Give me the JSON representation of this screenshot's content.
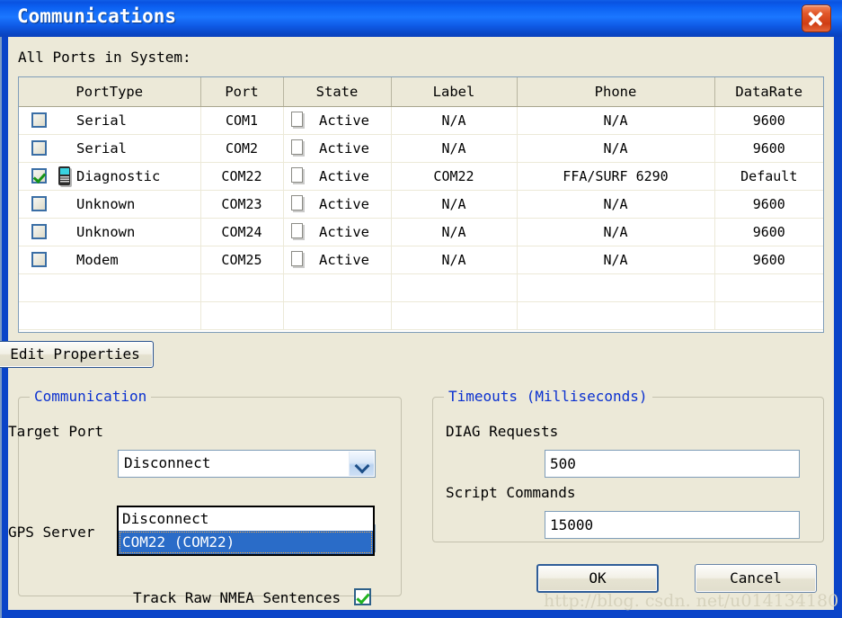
{
  "window": {
    "title": "Communications",
    "close_icon": "close-icon",
    "accent_titlebar": "#1b77ff",
    "frame_color": "#0a44c8",
    "face_color": "#ece9d8"
  },
  "ports_section": {
    "heading": "All Ports in System:",
    "columns": [
      "PortType",
      "Port",
      "State",
      "Label",
      "Phone",
      "DataRate"
    ],
    "rows": [
      {
        "checked": false,
        "has_device_icon": false,
        "port_type": "Serial",
        "port": "COM1",
        "state": "Active",
        "label": "N/A",
        "phone": "N/A",
        "data_rate": "9600"
      },
      {
        "checked": false,
        "has_device_icon": false,
        "port_type": "Serial",
        "port": "COM2",
        "state": "Active",
        "label": "N/A",
        "phone": "N/A",
        "data_rate": "9600"
      },
      {
        "checked": true,
        "has_device_icon": true,
        "port_type": "Diagnostic",
        "port": "COM22",
        "state": "Active",
        "label": "COM22",
        "phone": "FFA/SURF 6290",
        "data_rate": "Default"
      },
      {
        "checked": false,
        "has_device_icon": false,
        "port_type": "Unknown",
        "port": "COM23",
        "state": "Active",
        "label": "N/A",
        "phone": "N/A",
        "data_rate": "9600"
      },
      {
        "checked": false,
        "has_device_icon": false,
        "port_type": "Unknown",
        "port": "COM24",
        "state": "Active",
        "label": "N/A",
        "phone": "N/A",
        "data_rate": "9600"
      },
      {
        "checked": false,
        "has_device_icon": false,
        "port_type": "Modem",
        "port": "COM25",
        "state": "Active",
        "label": "N/A",
        "phone": "N/A",
        "data_rate": "9600"
      }
    ],
    "empty_rows": 2,
    "edit_properties_label": "Edit Properties"
  },
  "communication_group": {
    "legend": "Communication",
    "target_port_label": "Target Port",
    "target_port_value": "Disconnect",
    "gps_server_label": "GPS Server",
    "gps_server_value": "Disconnect",
    "dropdown_open": {
      "options": [
        "Disconnect",
        "COM22 (COM22)"
      ],
      "selected_index": 1
    },
    "nmea_label": "Track Raw NMEA Sentences",
    "nmea_checked": true
  },
  "timeouts_group": {
    "legend": "Timeouts (Milliseconds)",
    "diag_requests_label": "DIAG Requests",
    "diag_requests_value": "500",
    "script_commands_label": "Script Commands",
    "script_commands_value": "15000"
  },
  "footer": {
    "ok_label": "OK",
    "cancel_label": "Cancel",
    "watermark": "http://blog. csdn. net/u014134180"
  }
}
